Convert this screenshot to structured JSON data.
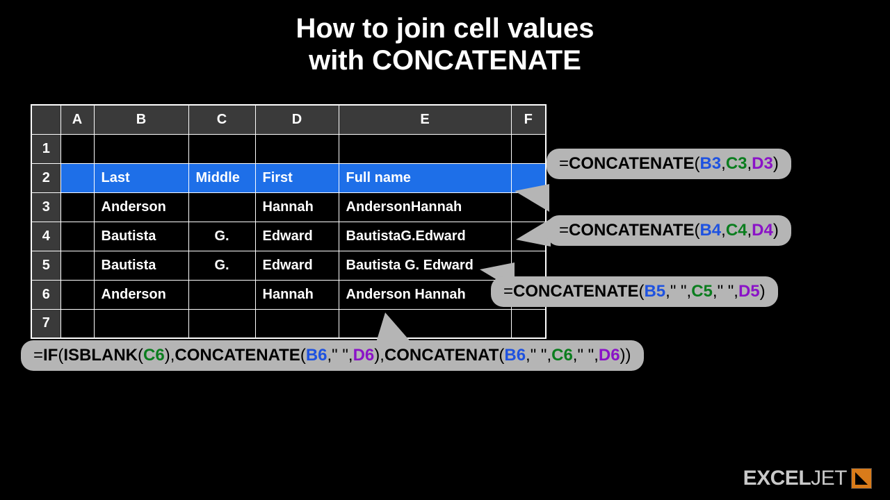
{
  "title_line1": "How to join cell values",
  "title_line2": "with CONCATENATE",
  "columns": [
    "A",
    "B",
    "C",
    "D",
    "E",
    "F"
  ],
  "rows": [
    "1",
    "2",
    "3",
    "4",
    "5",
    "6",
    "7"
  ],
  "headers": {
    "B": "Last",
    "C": "Middle",
    "D": "First",
    "E": "Full name"
  },
  "data": {
    "r3": {
      "B": "Anderson",
      "C": "",
      "D": "Hannah",
      "E": "AndersonHannah"
    },
    "r4": {
      "B": "Bautista",
      "C": "G.",
      "D": "Edward",
      "E": "BautistaG.Edward"
    },
    "r5": {
      "B": "Bautista",
      "C": "G.",
      "D": "Edward",
      "E": "Bautista G. Edward"
    },
    "r6": {
      "B": "Anderson",
      "C": "",
      "D": "Hannah",
      "E": "Anderson Hannah"
    }
  },
  "formulas": {
    "f3": {
      "eq": "=",
      "fn": "CONCATENATE",
      "o": "(",
      "a1": "B3",
      "c1": ",",
      "a2": "C3",
      "c2": ",",
      "a3": "D3",
      "cl": ")"
    },
    "f4": {
      "eq": "=",
      "fn": "CONCATENATE",
      "o": "(",
      "a1": "B4",
      "c1": ",",
      "a2": "C4",
      "c2": ",",
      "a3": "D4",
      "cl": ")"
    },
    "f5": {
      "eq": "=",
      "fn": "CONCATENATE",
      "o": "(",
      "a1": "B5",
      "c1": ",",
      "s1": "\" \"",
      "c2": ",",
      "a2": "C5",
      "c3": ",",
      "s2": "\" \"",
      "c4": ",",
      "a3": "D5",
      "cl": ")"
    },
    "f6": {
      "eq": "=",
      "fn1": "IF",
      "o1": "(",
      "fn2": "ISBLANK",
      "o2": "(",
      "a1": "C6",
      "cl2": ")",
      "c1": ",",
      "fn3": "CONCATENATE",
      "o3": "(",
      "a2": "B6",
      "c2": ",",
      "s1": "\" \"",
      "c3": ",",
      "a3": "D6",
      "cl3": ")",
      "c4": ",",
      "fn4": "CONCATENAT",
      "o4": "(",
      "a4": "B6",
      "c5": ",",
      "s2": "\" \"",
      "c6": ",",
      "a5": "C6",
      "c7": ",",
      "s3": "\" \"",
      "c8": ",",
      "a6": "D6",
      "cl4": ")",
      "cl1": ")"
    }
  },
  "logo": {
    "part1": "EXCEL",
    "part2": "JET"
  }
}
